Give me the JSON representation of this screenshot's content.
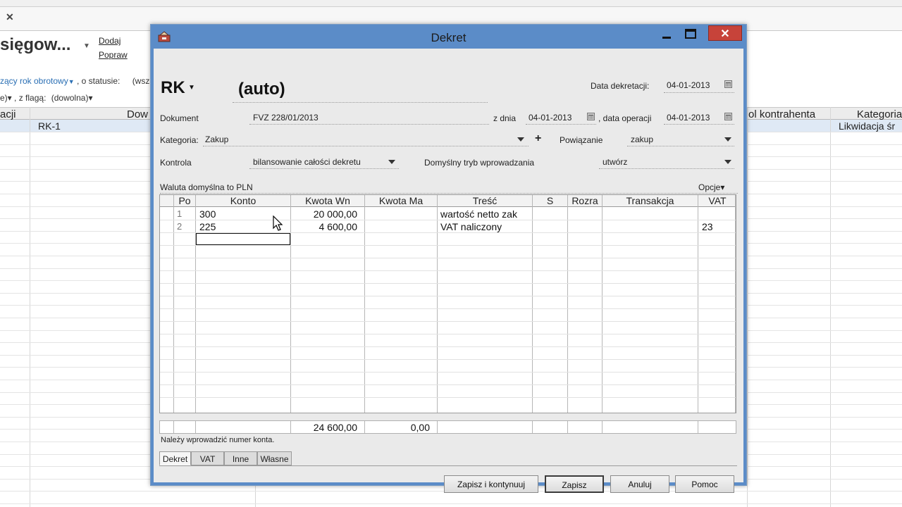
{
  "background": {
    "title": "sięgow...",
    "add_link": "Dodaj",
    "edit_link": "Popraw",
    "filter_line1": {
      "year_link": "zący rok obrotowy",
      "status_label": ", o statusie:",
      "status_value": "(wsz"
    },
    "filter_line2": {
      "prefix": "e)▾",
      "flag_label": ", z flagą:",
      "flag_value": "(dowolna)▾"
    },
    "columns": {
      "c1": "acji",
      "c2": "Dow",
      "c3": "ol kontrahenta",
      "c4": "Kategoria"
    },
    "first_row": {
      "doc": "RK-1",
      "category": "Likwidacja śr"
    }
  },
  "dialog": {
    "title": "Dekret",
    "journal_prefix": "RK",
    "number": "(auto)",
    "data_dekretacji_label": "Data dekretacji:",
    "data_dekretacji_value": "04-01-2013",
    "dokument_label": "Dokument",
    "dokument_value": "FVZ 228/01/2013",
    "z_dnia_label": "z dnia",
    "z_dnia_value": "04-01-2013",
    "data_operacji_label": ", data operacji",
    "data_operacji_value": "04-01-2013",
    "kategoria_label": "Kategoria:",
    "kategoria_value": "Zakup",
    "add_symbol": "+",
    "powiazanie_label": "Powiązanie",
    "powiazanie_value": "zakup",
    "kontrola_label": "Kontrola",
    "kontrola_value": "bilansowanie całości dekretu",
    "tryb_label": "Domyślny tryb wprowadzania",
    "tryb_value": "utwórz",
    "waluta_text": "Waluta domyślna to PLN",
    "opcje_label": "Opcje▾",
    "grid": {
      "headers": [
        "Po",
        "Konto",
        "Kwota Wn",
        "Kwota Ma",
        "Treść",
        "S",
        "Rozra",
        "Transakcja",
        "VAT"
      ],
      "rows": [
        {
          "po": "1",
          "konto": "300",
          "wn": "20 000,00",
          "ma": "",
          "tresc": "wartość netto zak",
          "s": "",
          "rozra": "",
          "transakcja": "",
          "vat": ""
        },
        {
          "po": "2",
          "konto": "225",
          "wn": "4 600,00",
          "ma": "",
          "tresc": "VAT naliczony",
          "s": "",
          "rozra": "",
          "transakcja": "",
          "vat": "23"
        }
      ]
    },
    "totals": {
      "wn": "24 600,00",
      "ma": "0,00"
    },
    "status_message": "Należy wprowadzić numer konta.",
    "tabs": [
      "Dekret",
      "VAT",
      "Inne",
      "Własne"
    ],
    "buttons": {
      "save_continue": "Zapisz i kontynuuj",
      "save": "Zapisz",
      "cancel": "Anuluj",
      "help": "Pomoc"
    }
  },
  "colors": {
    "titlebar": "#5b8cc8",
    "close_button": "#c7433a",
    "selected_row": "#dfe9f5"
  }
}
